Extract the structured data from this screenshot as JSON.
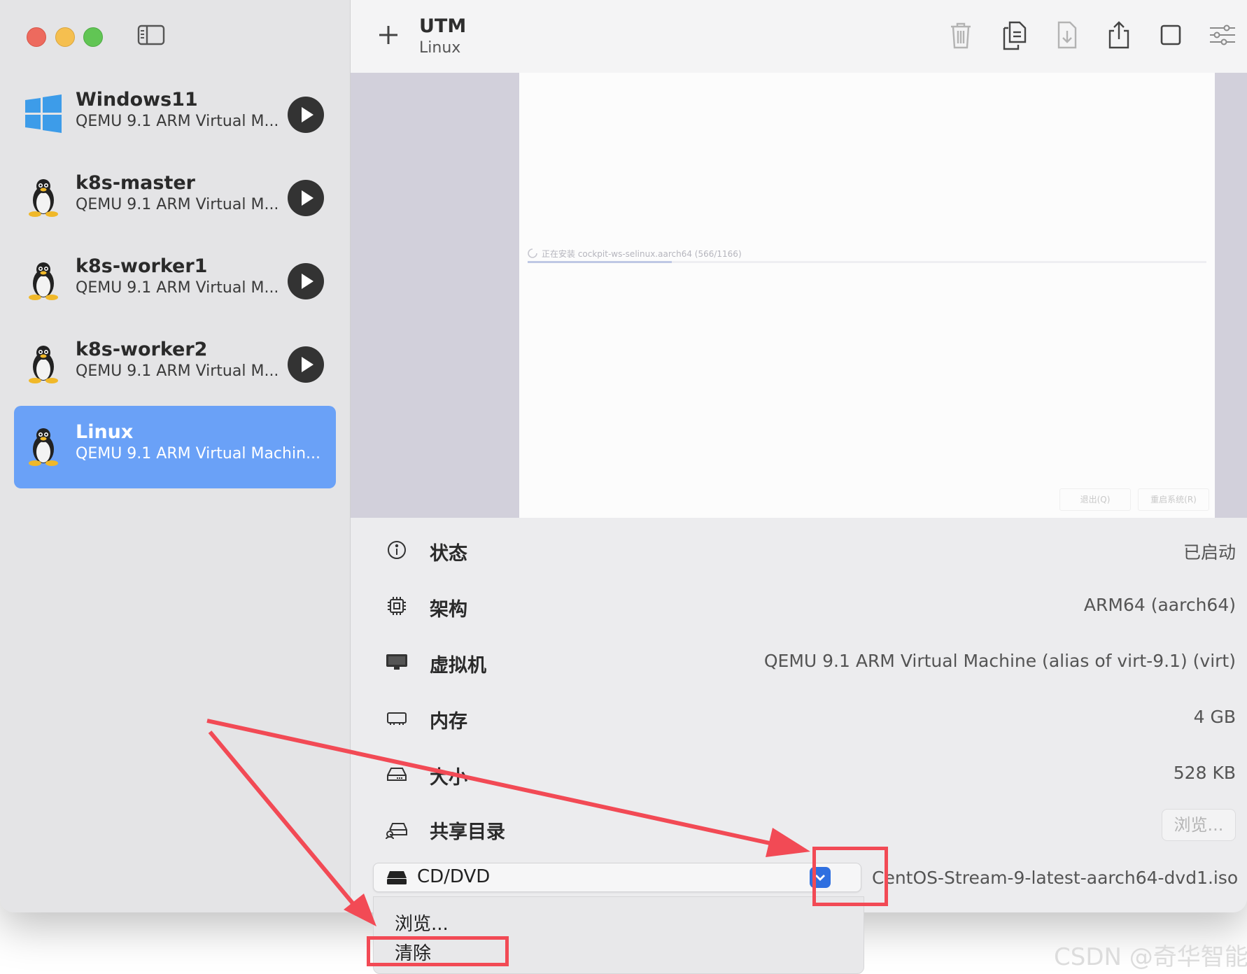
{
  "app": {
    "title": "UTM",
    "subtitle": "Linux"
  },
  "sidebar": {
    "items": [
      {
        "name": "Windows11",
        "desc": "QEMU 9.1 ARM Virtual M...",
        "os": "windows-logo-icon",
        "selected": false
      },
      {
        "name": "k8s-master",
        "desc": "QEMU 9.1 ARM Virtual M...",
        "os": "linux-tux-icon",
        "selected": false
      },
      {
        "name": "k8s-worker1",
        "desc": "QEMU 9.1 ARM Virtual M...",
        "os": "linux-tux-icon",
        "selected": false
      },
      {
        "name": "k8s-worker2",
        "desc": "QEMU 9.1 ARM Virtual M...",
        "os": "linux-tux-icon",
        "selected": false
      },
      {
        "name": "Linux",
        "desc": "QEMU 9.1 ARM Virtual Machin...",
        "os": "linux-tux-icon",
        "selected": true
      }
    ]
  },
  "toolbar": {
    "icons": [
      "trash-icon",
      "clone-icon",
      "download-icon",
      "share-icon",
      "stop-icon",
      "settings-sliders-icon"
    ]
  },
  "preview": {
    "install_text": "正在安装 cockpit-ws-selinux.aarch64 (566/1166)",
    "progress": 0.2126,
    "quit_button": "退出(Q)",
    "reboot_button": "重启系统(R)"
  },
  "info": {
    "rows": [
      {
        "icon": "info-icon",
        "label": "状态",
        "value": "已启动"
      },
      {
        "icon": "cpu-icon",
        "label": "架构",
        "value": "ARM64 (aarch64)"
      },
      {
        "icon": "display-icon",
        "label": "虚拟机",
        "value": "QEMU 9.1 ARM Virtual Machine (alias of virt-9.1) (virt)"
      },
      {
        "icon": "memory-icon",
        "label": "内存",
        "value": "4 GB"
      },
      {
        "icon": "drive-icon",
        "label": "大小",
        "value": "528 KB"
      },
      {
        "icon": "shared-drive-icon",
        "label": "共享目录",
        "value": ""
      }
    ],
    "shared_browse_label": "浏览...",
    "cd_label": "CD/DVD",
    "iso_name": "CentOS-Stream-9-latest-aarch64-dvd1.iso"
  },
  "menu": {
    "items": [
      "浏览...",
      "清除"
    ]
  },
  "watermark": "CSDN @奇华智能",
  "colors": {
    "selection": "#6aa1f7",
    "accent": "#2f6fe0",
    "annotation": "#f24a55"
  }
}
